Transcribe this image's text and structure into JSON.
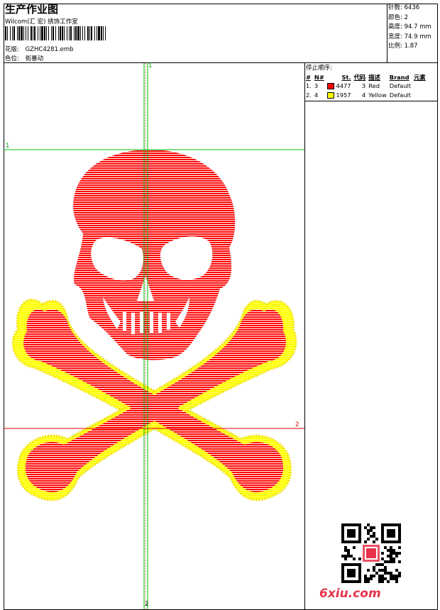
{
  "header": {
    "title": "生产作业图",
    "company": "Wilcom(汇 宏) 绣饰工作室",
    "design_label": "花版:",
    "design_value": "GZHC4281.emb",
    "color_label": "色位:",
    "color_value": "街暴动"
  },
  "stats": {
    "stitches_label": "针数:",
    "stitches_value": "6436",
    "colors_label": "颜色:",
    "colors_value": "2",
    "height_label": "高度:",
    "height_value": "94.7 mm",
    "width_label": "宽度:",
    "width_value": "74.9 mm",
    "scale_label": "比例:",
    "scale_value": "1.87"
  },
  "stop_sequence": {
    "title": "停止顺序:",
    "headers": [
      "#",
      "N#",
      "St.",
      "代码",
      "描述",
      "Brand",
      "元素"
    ],
    "rows": [
      {
        "index": "1.",
        "n": "3",
        "color": "#ff0000",
        "stitches": "4477",
        "code": "3",
        "desc": "Red",
        "brand": "Default"
      },
      {
        "index": "2.",
        "n": "4",
        "color": "#ffff00",
        "stitches": "1957",
        "code": "4",
        "desc": "Yellow",
        "brand": "Default"
      }
    ]
  },
  "guides": {
    "green_top": "1",
    "green_left": "1",
    "red_right": "2",
    "bottom": "2"
  },
  "watermark": "6xiu.com",
  "colors": {
    "thread_red": "#ff0000",
    "thread_yellow": "#ffff00",
    "guide_green": "#00c000",
    "guide_red": "#e00000"
  },
  "icons": {
    "barcode": "barcode-icon",
    "qr": "qr-code-icon"
  }
}
